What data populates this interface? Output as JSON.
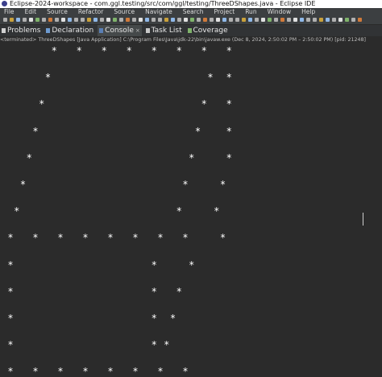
{
  "window": {
    "title": "Eclipse-2024-workspace - com.ggl.testing/src/com/ggl/testing/ThreeDShapes.java - Eclipse IDE"
  },
  "menu": [
    "File",
    "Edit",
    "Source",
    "Refactor",
    "Source",
    "Navigate",
    "Search",
    "Project",
    "Run",
    "Window",
    "Help"
  ],
  "tabs": [
    {
      "label": "Problems",
      "icon": "problems-icon",
      "active": false
    },
    {
      "label": "Declaration",
      "icon": "declaration-icon",
      "active": false
    },
    {
      "label": "Console",
      "icon": "console-icon",
      "active": true,
      "close": "×"
    },
    {
      "label": "Task List",
      "icon": "task-list-icon",
      "active": false
    },
    {
      "label": "Coverage",
      "icon": "coverage-icon",
      "active": false
    }
  ],
  "console": {
    "status": "<terminated> ThreeDShapes [Java Application] C:\\Program Files\\Java\\jdk-22\\bin\\javaw.exe  (Dec 8, 2024, 2:50:02 PM – 2:50:02 PM) [pid: 21248]",
    "star_char": "*",
    "lines": [
      "       *   *   *   *   *   *   *   *",
      "      *                         *  *",
      "     *                         *   *",
      "    *                         *    *",
      "   *                         *     *",
      "  *                         *     *",
      " *                         *     *",
      "*   *   *   *   *   *   *   *     *",
      "*                      *     *",
      "*                      *   *",
      "*                      *  *",
      "*                      * *",
      "*   *   *   *   *   *   *   *"
    ]
  },
  "colors": {
    "background": "#2b2b2b",
    "text": "#ffffff",
    "menu_bg": "#3c3f41",
    "tab_active_bg": "#45494a"
  }
}
